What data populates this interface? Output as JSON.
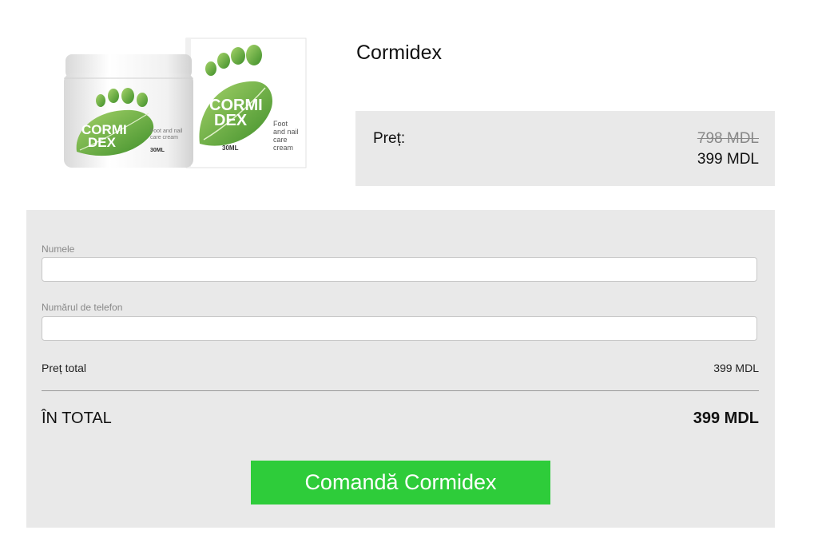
{
  "product": {
    "title": "Cormidex",
    "image": {
      "jar_brand_line1": "CORMI",
      "jar_brand_line2": "DEX",
      "jar_subtitle_line1": "Foot and nail",
      "jar_subtitle_line2": "care cream",
      "jar_volume": "30ML",
      "box_brand_line1": "CORMI",
      "box_brand_line2": "DEX",
      "box_subtitle_line1": "Foot",
      "box_subtitle_line2": "and nail",
      "box_subtitle_line3": "care",
      "box_subtitle_line4": "cream",
      "box_volume": "30ML"
    }
  },
  "price_box": {
    "label": "Preț:",
    "old_price": "798 MDL",
    "new_price": "399 MDL"
  },
  "form": {
    "name_label": "Numele",
    "name_value": "",
    "phone_label": "Numărul de telefon",
    "phone_value": "",
    "subtotal_label": "Preț total",
    "subtotal_value": "399 MDL",
    "total_label": "ÎN TOTAL",
    "total_value": "399 MDL",
    "submit_label": "Comandă Cormidex"
  },
  "colors": {
    "panel_bg": "#e9e9e9",
    "button_green": "#2ecc3a",
    "leaf_green": "#6bb33a"
  }
}
